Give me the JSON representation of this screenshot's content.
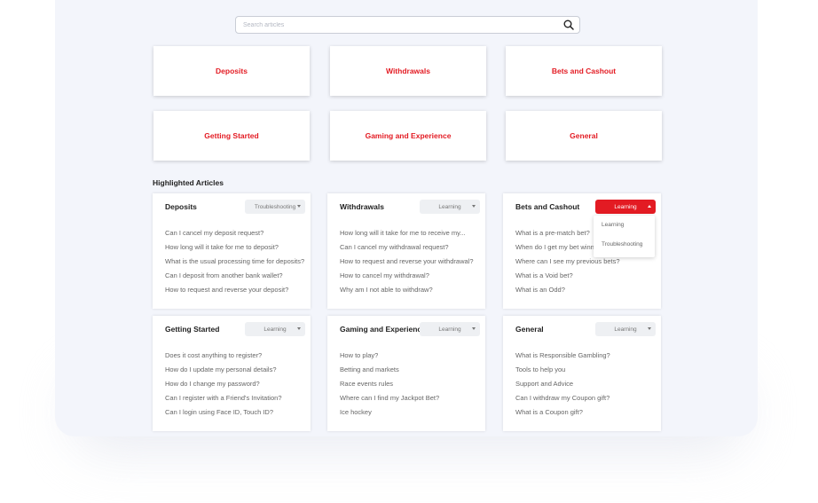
{
  "search": {
    "placeholder": "Search articles"
  },
  "categories": [
    "Deposits",
    "Withdrawals",
    "Bets and Cashout",
    "Getting Started",
    "Gaming and Experience",
    "General"
  ],
  "highlighted": {
    "title": "Highlighted Articles",
    "cards": [
      {
        "title": "Deposits",
        "filter": "Troubleshooting",
        "questions": [
          "Can I cancel my deposit request?",
          "How long will it take for me to deposit?",
          "What is the usual processing time for deposits?",
          "Can I deposit from another bank wallet?",
          "How to request and reverse your deposit?"
        ]
      },
      {
        "title": "Withdrawals",
        "filter": "Learning",
        "questions": [
          "How long will it take for me to receive my...",
          "Can I cancel my withdrawal request?",
          "How to request and reverse your withdrawal?",
          "How to cancel my withdrawal?",
          "Why am I not able to withdraw?"
        ]
      },
      {
        "title": "Bets and Cashout",
        "filter": "Learning",
        "questions": [
          "What is a pre-match bet?",
          "When do I get my bet winni...",
          "Where can I see my previous bets?",
          "What is a Void bet?",
          "What is an Odd?"
        ]
      },
      {
        "title": "Getting Started",
        "filter": "Learning",
        "questions": [
          " Does it cost anything to register?",
          "How do I update my personal details?",
          "How do I change my password?",
          "Can I register with a Friend's Invitation?",
          "Can I login using Face ID, Touch ID?"
        ]
      },
      {
        "title": "Gaming and Experience",
        "filter": "Learning",
        "questions": [
          "How to play?",
          "Betting and markets",
          "Race events rules",
          "Where can I find my Jackpot Bet?",
          "Ice hockey"
        ]
      },
      {
        "title": "General",
        "filter": "Learning",
        "questions": [
          "What is Responsible Gambling?",
          "Tools to help you",
          "Support and Advice",
          "Can I withdraw my Coupon gift?",
          "What is a Coupon gift?"
        ]
      }
    ]
  },
  "filter_menu": {
    "options": [
      "Learning",
      "Troubleshooting"
    ]
  },
  "colors": {
    "accent": "#e31b23"
  }
}
